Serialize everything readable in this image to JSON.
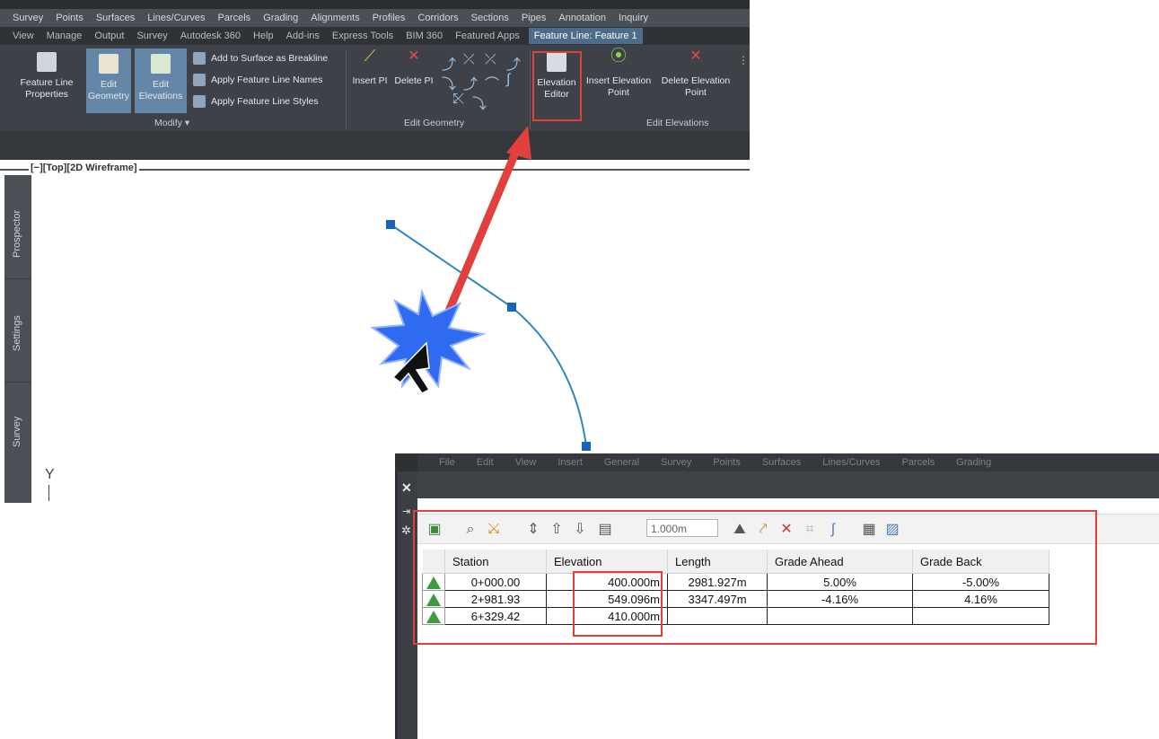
{
  "ribbon": {
    "menu": [
      "Survey",
      "Points",
      "Surfaces",
      "Lines/Curves",
      "Parcels",
      "Grading",
      "Alignments",
      "Profiles",
      "Corridors",
      "Sections",
      "Pipes",
      "Annotation",
      "Inquiry"
    ],
    "tabs": [
      "View",
      "Manage",
      "Output",
      "Survey",
      "Autodesk 360",
      "Help",
      "Add-ins",
      "Express Tools",
      "BIM 360",
      "Featured Apps"
    ],
    "context_tab": "Feature Line: Feature 1",
    "modify": {
      "feature_line_properties": "Feature Line Properties",
      "edit_geometry": "Edit Geometry",
      "edit_elevations": "Edit Elevations",
      "add_to_surface": "Add to Surface as Breakline",
      "apply_names": "Apply Feature Line Names",
      "apply_styles": "Apply Feature Line Styles",
      "panel_label": "Modify"
    },
    "edit_geometry": {
      "insert_pi": "Insert PI",
      "delete_pi": "Delete PI",
      "panel_label": "Edit Geometry"
    },
    "edit_elevations": {
      "elevation_editor": "Elevation Editor",
      "insert_elevation_point": "Insert Elevation Point",
      "delete_elevation_point": "Delete Elevation Point",
      "panel_label": "Edit Elevations"
    }
  },
  "viewport": {
    "label": "[−][Top][2D Wireframe]",
    "axis_label": "Y"
  },
  "side_palette": [
    "Prospector",
    "Settings",
    "Survey"
  ],
  "palette": {
    "menu": [
      "File",
      "Edit",
      "View",
      "Insert",
      "General",
      "Survey",
      "Points",
      "Surfaces",
      "Lines/Curves",
      "Parcels",
      "Grading"
    ],
    "interval": "1.000m",
    "columns": [
      "Station",
      "Elevation",
      "Length",
      "Grade Ahead",
      "Grade Back"
    ],
    "rows": [
      {
        "station": "0+000.00",
        "elevation": "400.000m",
        "length": "2981.927m",
        "grade_ahead": "5.00%",
        "grade_back": "-5.00%"
      },
      {
        "station": "2+981.93",
        "elevation": "549.096m",
        "length": "3347.497m",
        "grade_ahead": "-4.16%",
        "grade_back": "4.16%"
      },
      {
        "station": "6+329.42",
        "elevation": "410.000m",
        "length": "",
        "grade_ahead": "",
        "grade_back": ""
      }
    ]
  },
  "colors": {
    "highlight": "#e2403c",
    "ribbon_bg": "#3e4248",
    "vertex_marker": "#1565c0",
    "curve": "#2e86c1",
    "tri_icon": "#3e9a3e"
  }
}
